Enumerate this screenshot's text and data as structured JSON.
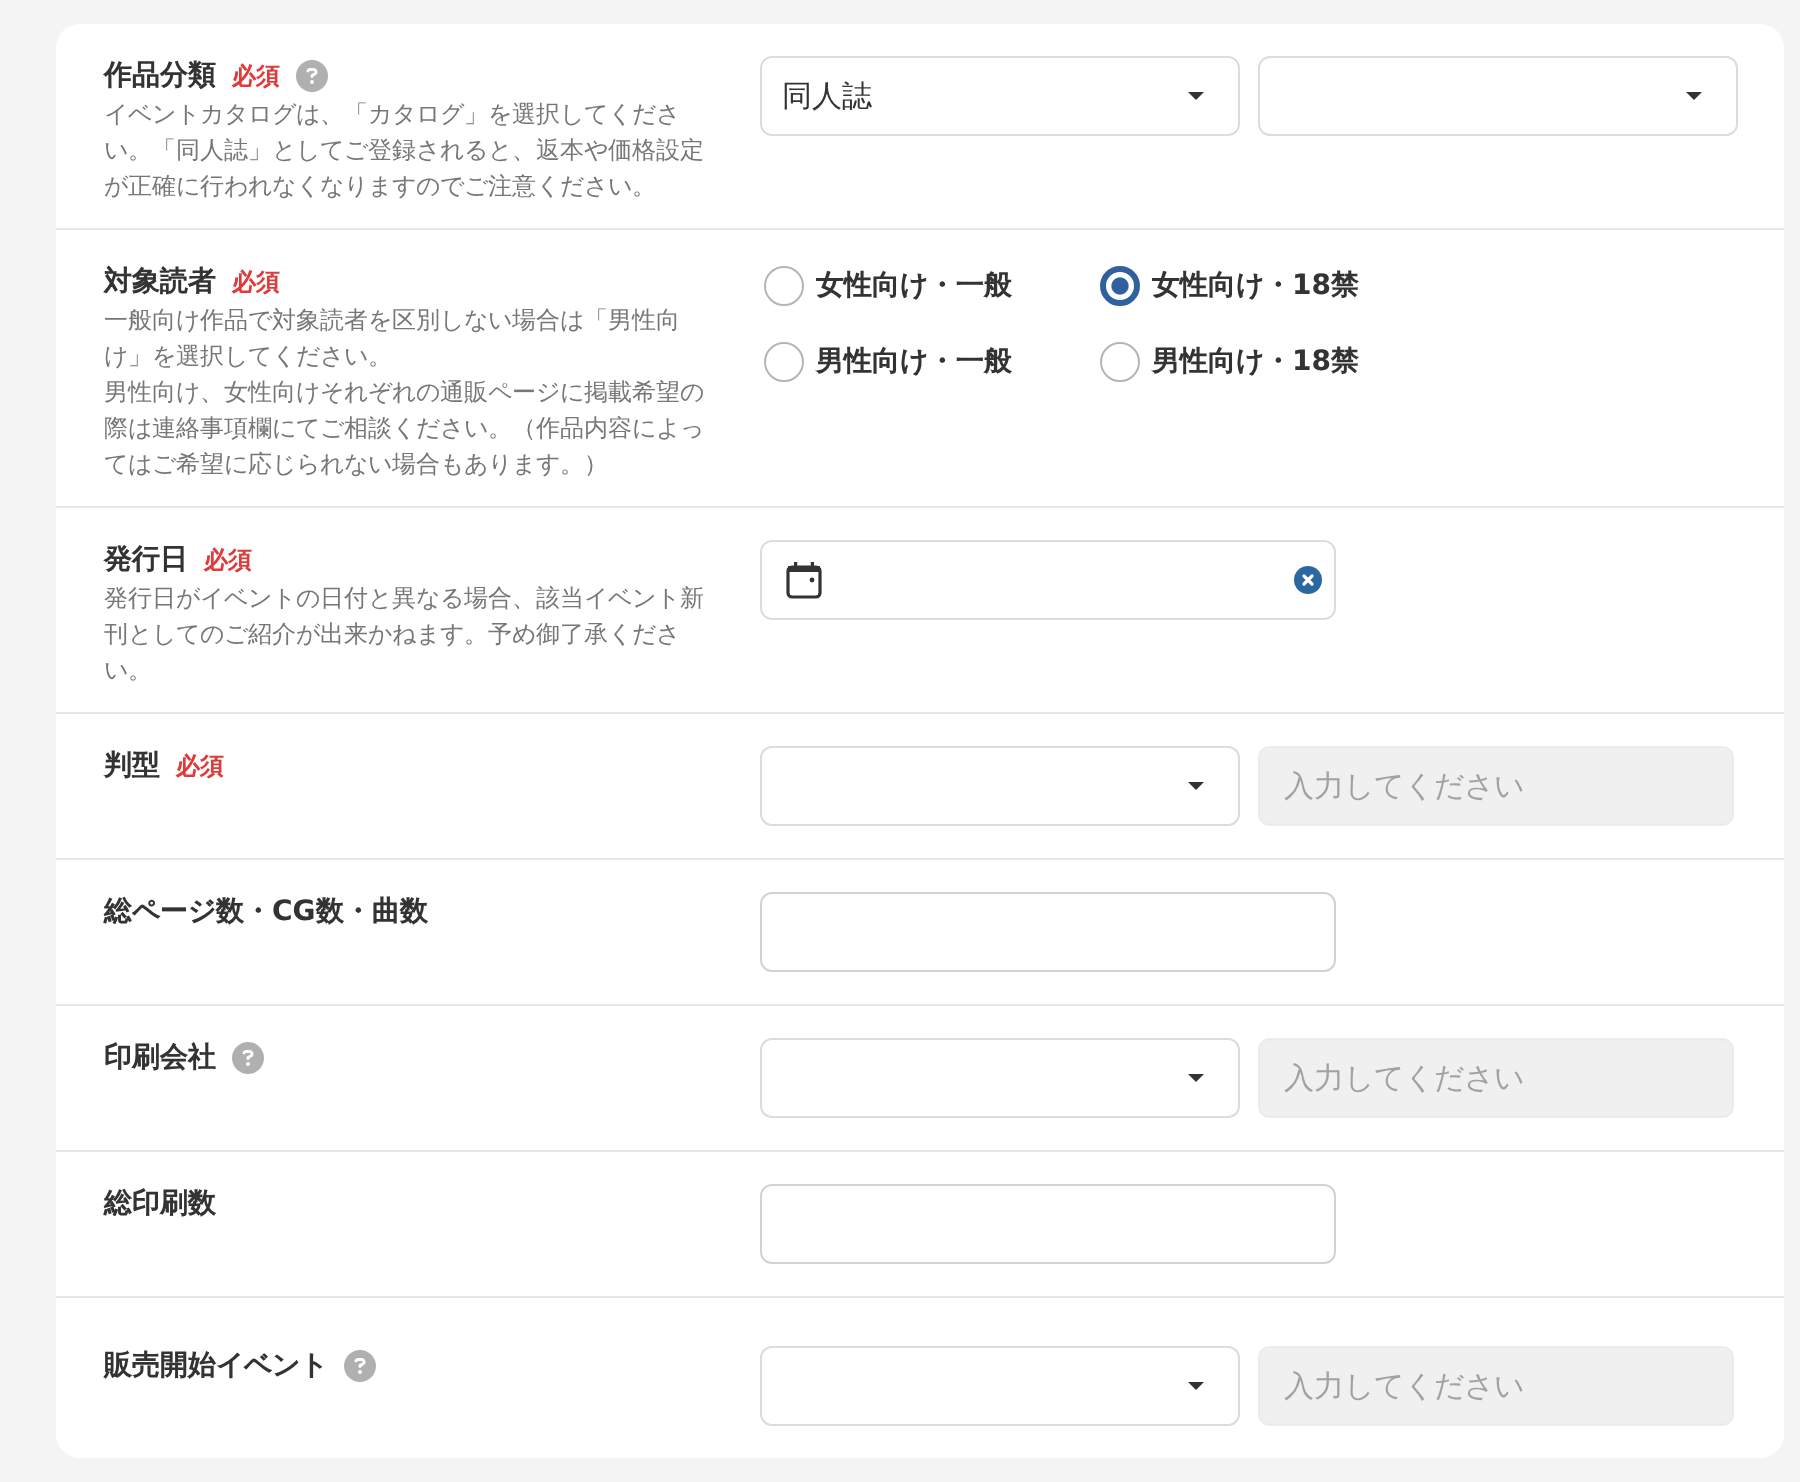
{
  "fields": [
    {
      "label": "作品分類",
      "badge": "必須",
      "help": true,
      "description": [
        "イベントカタログは、「カタログ」を選択してください。「同人誌」としてご登録されると、返本や価格設定が正確に行われなくなりますのでご注意ください。"
      ],
      "controls": [
        {
          "kind": "select",
          "value": "同人誌"
        },
        {
          "kind": "select"
        }
      ]
    },
    {
      "label": "対象読者",
      "badge": "必須",
      "help": false,
      "description": [
        "一般向け作品で対象読者を区別しない場合は「男性向け」を選択してください。",
        "男性向け、女性向けそれぞれの通販ページに掲載希望の際は連絡事項欄にてご相談ください。（作品内容によってはご希望に応じられない場合もあります。）"
      ],
      "controls": [
        {
          "kind": "radio_group",
          "options": [
            {
              "label": "女性向け・一般",
              "selected": false
            },
            {
              "label": "女性向け・18禁",
              "selected": true
            },
            {
              "label": "男性向け・一般",
              "selected": false
            },
            {
              "label": "男性向け・18禁",
              "selected": false
            }
          ]
        }
      ]
    },
    {
      "label": "発行日",
      "badge": "必須",
      "help": false,
      "description": [
        "発行日がイベントの日付と異なる場合、該当イベント新刊としてのご紹介が出来かねます。予め御了承ください。"
      ],
      "controls": [
        {
          "kind": "date"
        }
      ]
    },
    {
      "label": "判型",
      "badge": "必須",
      "help": false,
      "controls": [
        {
          "kind": "select"
        },
        {
          "kind": "text",
          "placeholder": "入力してください",
          "disabled": true
        }
      ]
    },
    {
      "label": "総ページ数・CG数・曲数",
      "help": false,
      "controls": [
        {
          "kind": "text",
          "disabled": false
        }
      ]
    },
    {
      "label": "印刷会社",
      "help": true,
      "controls": [
        {
          "kind": "select"
        },
        {
          "kind": "text",
          "placeholder": "入力してください",
          "disabled": true
        }
      ]
    },
    {
      "label": "総印刷数",
      "help": false,
      "controls": [
        {
          "kind": "text",
          "disabled": false
        }
      ]
    },
    {
      "label": "販売開始イベント",
      "help": true,
      "controls": [
        {
          "kind": "select"
        },
        {
          "kind": "text",
          "placeholder": "入力してください",
          "disabled": true
        }
      ]
    }
  ]
}
